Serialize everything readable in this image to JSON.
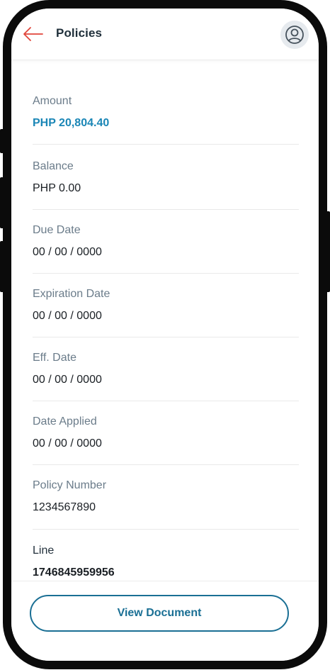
{
  "header": {
    "title": "Policies",
    "back_icon": "arrow-left-icon",
    "profile_icon": "user-circle-icon"
  },
  "colors": {
    "accent": "#1a86b6",
    "back_arrow": "#e0463b",
    "button_border": "#1a6f94"
  },
  "details": [
    {
      "label": "Amount",
      "value": "PHP 20,804.40"
    },
    {
      "label": "Balance",
      "value": "PHP 0.00"
    },
    {
      "label": "Due Date",
      "value": "00 / 00 / 0000"
    },
    {
      "label": "Expiration Date",
      "value": "00 / 00 / 0000"
    },
    {
      "label": "Eff. Date",
      "value": "00 / 00 / 0000"
    },
    {
      "label": "Date Applied",
      "value": "00 / 00 / 0000"
    },
    {
      "label": "Policy Number",
      "value": "1234567890"
    },
    {
      "label": "Line",
      "value": "1746845959956"
    }
  ],
  "footer": {
    "view_document_label": "View Document"
  }
}
